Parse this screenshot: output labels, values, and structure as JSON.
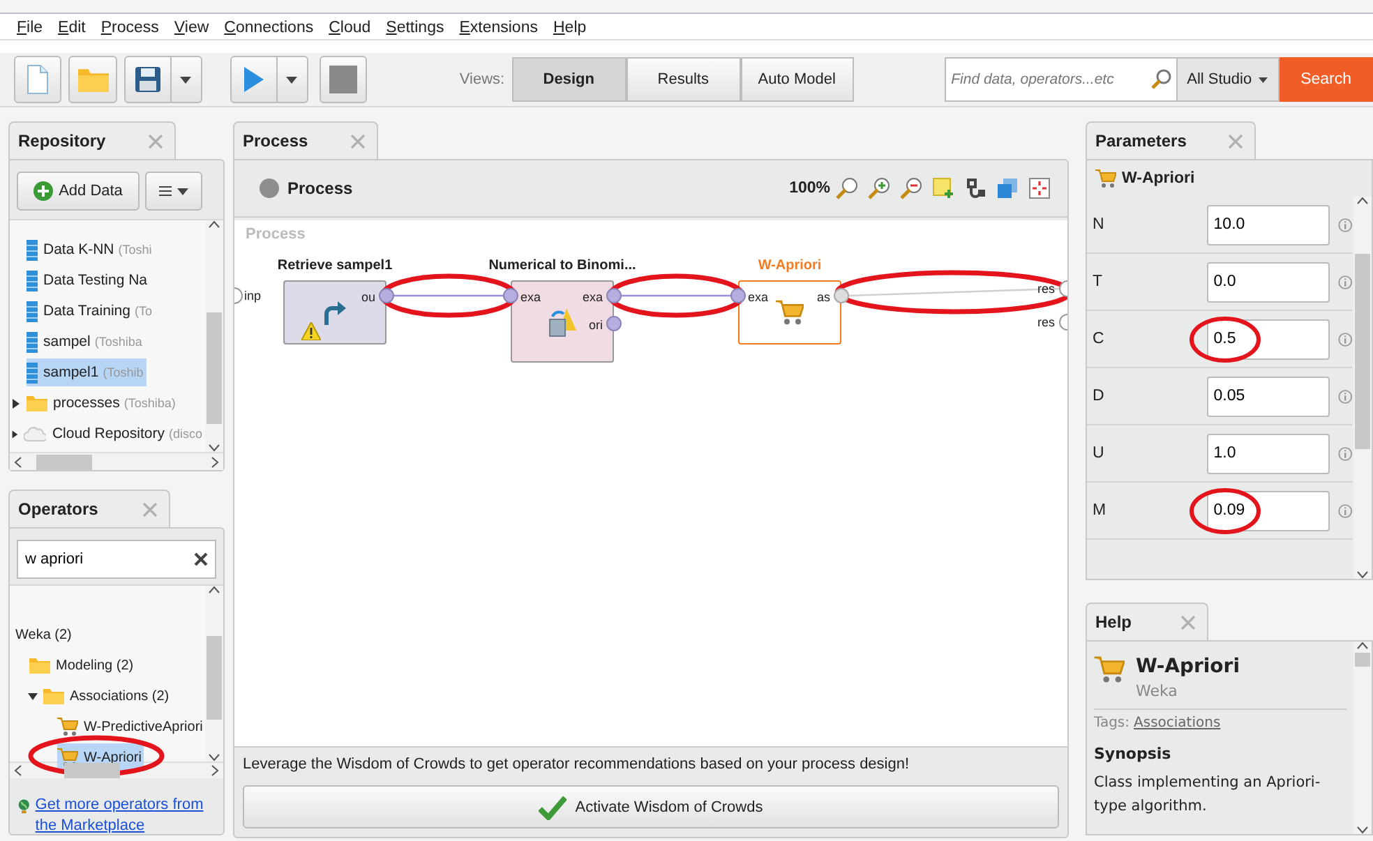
{
  "menu": [
    "File",
    "Edit",
    "Process",
    "View",
    "Connections",
    "Cloud",
    "Settings",
    "Extensions",
    "Help"
  ],
  "toolbar": {
    "views_label": "Views:",
    "views": [
      {
        "label": "Design",
        "selected": true
      },
      {
        "label": "Results",
        "selected": false
      },
      {
        "label": "Auto Model",
        "selected": false
      }
    ],
    "search": {
      "placeholder": "Find data, operators...etc"
    },
    "scope": "All Studio",
    "search_button": "Search"
  },
  "repository": {
    "title": "Repository",
    "add_button": "Add Data",
    "tree": [
      {
        "kind": "hidden",
        "children": [
          {
            "kind": "hidden",
            "children": [
              {
                "kind": "data",
                "name": "Data K-NN",
                "location": "(Toshi",
                "selected": false
              },
              {
                "kind": "data",
                "name": "Data Testing Na",
                "selected": false
              },
              {
                "kind": "data",
                "name": "Data Training",
                "location": "(To",
                "selected": false
              },
              {
                "kind": "data",
                "name": "sampel",
                "location": "(Toshiba",
                "selected": false
              },
              {
                "kind": "data",
                "name": "sampel1",
                "location": "(Toshib",
                "selected": true
              }
            ]
          },
          {
            "kind": "folder",
            "name": "processes",
            "location": "(Toshiba)",
            "expanded": false,
            "selected": false
          }
        ]
      },
      {
        "kind": "cloud",
        "name": "Cloud Repository",
        "location": "(disco",
        "expanded": false,
        "selected": false
      }
    ]
  },
  "operators": {
    "title": "Operators",
    "search": {
      "value": "w apriori"
    },
    "tree": [
      {
        "kind": "hidden",
        "children": [
          {
            "kind": "group",
            "name": "Weka (2)",
            "children": [
              {
                "kind": "folder",
                "name": "Modeling (2)",
                "children": [
                  {
                    "kind": "folder",
                    "name": "Associations (2)",
                    "expanded": true,
                    "children": [
                      {
                        "kind": "operator",
                        "name": "W-PredictiveApriori",
                        "selected": false,
                        "highlighted": false
                      },
                      {
                        "kind": "operator",
                        "name": "W-Apriori",
                        "selected": true,
                        "highlighted": true
                      }
                    ]
                  }
                ]
              }
            ]
          }
        ]
      }
    ],
    "marketplace_link": "Get more operators from the Marketplace"
  },
  "process": {
    "tab": "Process",
    "breadcrumb": "Process",
    "zoom": "100%",
    "canvas_label": "Process",
    "inputs": [
      "inp"
    ],
    "outputs": [
      "res",
      "res"
    ],
    "operators": [
      {
        "kind": "retrieve",
        "name": "Retrieve sampel1",
        "selected": false,
        "warning": true,
        "outputs": [
          "ou"
        ]
      },
      {
        "kind": "convert",
        "name": "Numerical to Binomi...",
        "selected": false,
        "warning": false,
        "inputs": [
          "exa"
        ],
        "outputs": [
          "exa",
          "ori"
        ]
      },
      {
        "kind": "learner",
        "name": "W-Apriori",
        "selected": true,
        "warning": false,
        "inputs": [
          "exa"
        ],
        "outputs": [
          "as"
        ]
      }
    ],
    "connections": [
      {
        "highlighted": true
      },
      {
        "highlighted": true
      },
      {
        "highlighted": true
      }
    ],
    "wisdom": {
      "text": "Leverage the Wisdom of Crowds to get operator recommendations based on your process design!",
      "button": "Activate Wisdom of Crowds"
    }
  },
  "parameters": {
    "title": "Parameters",
    "operator": "W-Apriori",
    "params": [
      {
        "name": "N",
        "value": "10.0",
        "highlighted": false
      },
      {
        "name": "T",
        "value": "0.0",
        "highlighted": false
      },
      {
        "name": "C",
        "value": "0.5",
        "highlighted": true
      },
      {
        "name": "D",
        "value": "0.05",
        "highlighted": false
      },
      {
        "name": "U",
        "value": "1.0",
        "highlighted": false
      },
      {
        "name": "M",
        "value": "0.09",
        "highlighted": true
      }
    ]
  },
  "help": {
    "title": "Help",
    "operator": "W-Apriori",
    "group": "Weka",
    "tags_label": "Tags:",
    "tags": [
      "Associations"
    ],
    "synopsis_title": "Synopsis",
    "synopsis": "Class implementing an Apriori-type algorithm."
  }
}
